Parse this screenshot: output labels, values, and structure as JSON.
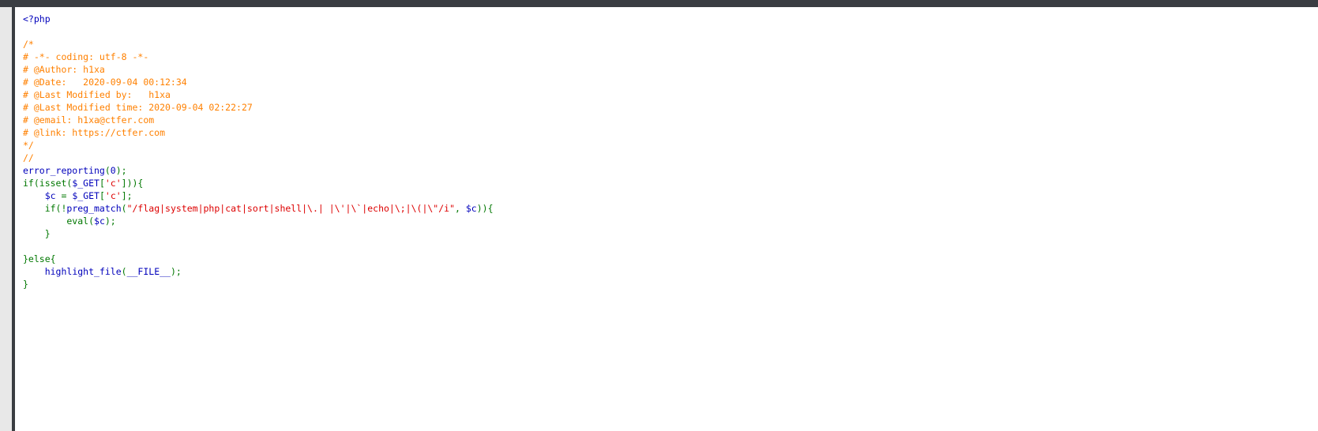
{
  "colors": {
    "html": "#0000BB",
    "comment": "#FF8000",
    "keyword": "#007700",
    "string": "#DD0000",
    "default": "#0000BB",
    "background": "#FFFFFF",
    "chrome": "#3A3D42"
  },
  "source": {
    "lines": [
      [
        {
          "t": "<?php",
          "c": "html"
        }
      ],
      [],
      [
        {
          "t": "/*",
          "c": "comment"
        }
      ],
      [
        {
          "t": "# -*- coding: utf-8 -*-",
          "c": "comment"
        }
      ],
      [
        {
          "t": "# @Author: h1xa",
          "c": "comment"
        }
      ],
      [
        {
          "t": "# @Date:   2020-09-04 00:12:34",
          "c": "comment"
        }
      ],
      [
        {
          "t": "# @Last Modified by:   h1xa",
          "c": "comment"
        }
      ],
      [
        {
          "t": "# @Last Modified time: 2020-09-04 02:22:27",
          "c": "comment"
        }
      ],
      [
        {
          "t": "# @email: h1xa@ctfer.com",
          "c": "comment"
        }
      ],
      [
        {
          "t": "# @link: https://ctfer.com",
          "c": "comment"
        }
      ],
      [
        {
          "t": "*/",
          "c": "comment"
        }
      ],
      [
        {
          "t": "//",
          "c": "comment"
        }
      ],
      [
        {
          "t": "error_reporting",
          "c": "default"
        },
        {
          "t": "(",
          "c": "keyword"
        },
        {
          "t": "0",
          "c": "default"
        },
        {
          "t": ");",
          "c": "keyword"
        }
      ],
      [
        {
          "t": "if(isset(",
          "c": "keyword"
        },
        {
          "t": "$_GET",
          "c": "default"
        },
        {
          "t": "[",
          "c": "keyword"
        },
        {
          "t": "'c'",
          "c": "string"
        },
        {
          "t": "])){",
          "c": "keyword"
        }
      ],
      [
        {
          "t": "    ",
          "c": "keyword"
        },
        {
          "t": "$c ",
          "c": "default"
        },
        {
          "t": "= ",
          "c": "keyword"
        },
        {
          "t": "$_GET",
          "c": "default"
        },
        {
          "t": "[",
          "c": "keyword"
        },
        {
          "t": "'c'",
          "c": "string"
        },
        {
          "t": "];",
          "c": "keyword"
        }
      ],
      [
        {
          "t": "    if(!",
          "c": "keyword"
        },
        {
          "t": "preg_match",
          "c": "default"
        },
        {
          "t": "(",
          "c": "keyword"
        },
        {
          "t": "\"/flag|system|php|cat|sort|shell|\\.| |\\'|\\`|echo|\\;|\\(|\\\"/i\"",
          "c": "string"
        },
        {
          "t": ", ",
          "c": "keyword"
        },
        {
          "t": "$c",
          "c": "default"
        },
        {
          "t": ")){",
          "c": "keyword"
        }
      ],
      [
        {
          "t": "        eval(",
          "c": "keyword"
        },
        {
          "t": "$c",
          "c": "default"
        },
        {
          "t": ");",
          "c": "keyword"
        }
      ],
      [
        {
          "t": "    }",
          "c": "keyword"
        }
      ],
      [],
      [
        {
          "t": "}else{",
          "c": "keyword"
        }
      ],
      [
        {
          "t": "    ",
          "c": "keyword"
        },
        {
          "t": "highlight_file",
          "c": "default"
        },
        {
          "t": "(",
          "c": "keyword"
        },
        {
          "t": "__FILE__",
          "c": "default"
        },
        {
          "t": ");",
          "c": "keyword"
        }
      ],
      [
        {
          "t": "}",
          "c": "keyword"
        }
      ]
    ]
  }
}
